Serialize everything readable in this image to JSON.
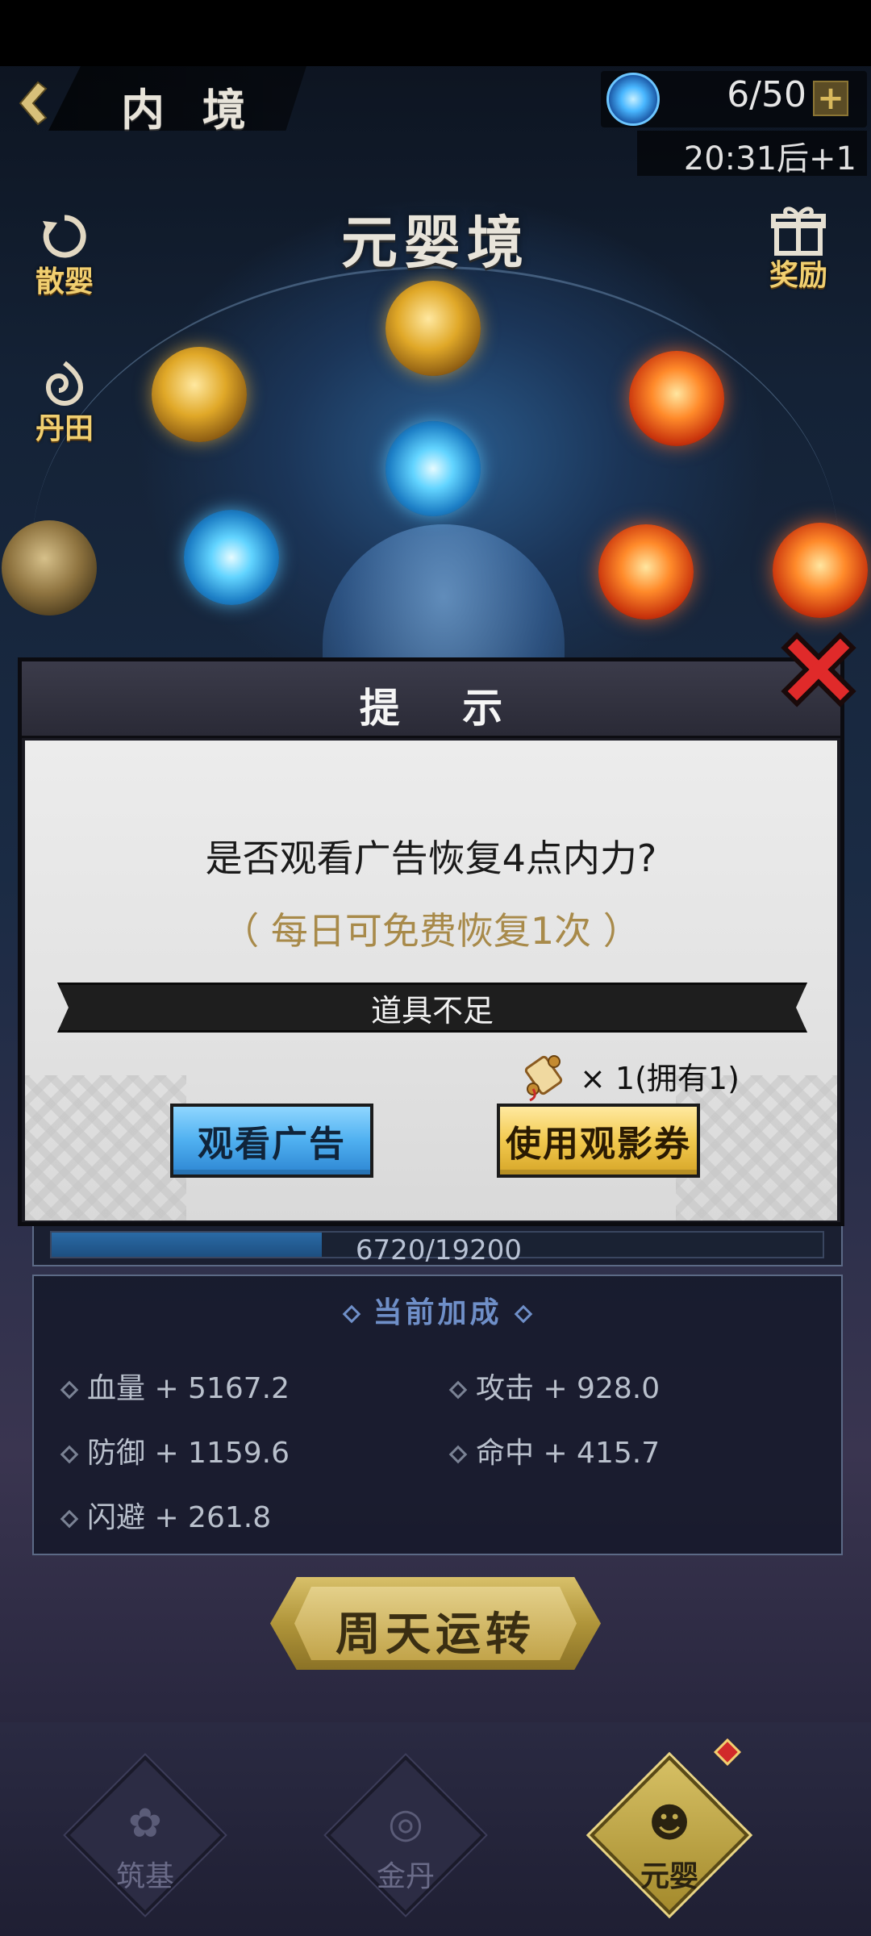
{
  "header": {
    "title": "内 境",
    "energy": "6/50",
    "energy_plus": "+",
    "timer": "20:31后+1"
  },
  "realm": {
    "title": "元婴境"
  },
  "side_buttons": {
    "disperse": "散婴",
    "dantian": "丹田",
    "reward": "奖励"
  },
  "progress": {
    "text": "6720/19200",
    "current": 6720,
    "max": 19200
  },
  "bonus": {
    "title": "当前加成",
    "stats": [
      {
        "label": "血量 + 5167.2"
      },
      {
        "label": "攻击 + 928.0"
      },
      {
        "label": "防御 + 1159.6"
      },
      {
        "label": "命中 + 415.7"
      },
      {
        "label": "闪避 + 261.8"
      }
    ]
  },
  "cycle_button": "周天运转",
  "bottom_nav": {
    "items": [
      {
        "label": "筑基"
      },
      {
        "label": "金丹"
      },
      {
        "label": "元婴"
      }
    ]
  },
  "modal": {
    "title": "提 示",
    "question": "是否观看广告恢复4点内力?",
    "free_note": "（ 每日可免费恢复1次 ）",
    "insufficient": "道具不足",
    "item_count": "× 1(拥有1)",
    "watch_ad_button": "观看广告",
    "use_ticket_button": "使用观影券"
  },
  "colors": {
    "accent_gold": "#f2c94e",
    "accent_blue": "#4fb0f0",
    "close_red": "#e02a2a"
  }
}
